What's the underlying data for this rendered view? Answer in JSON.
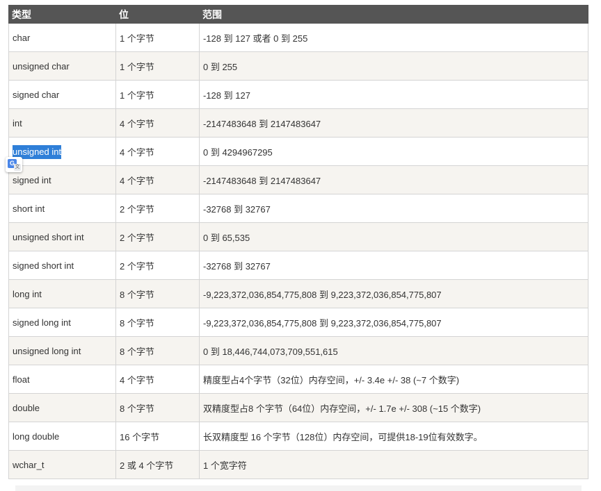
{
  "table": {
    "headers": [
      "类型",
      "位",
      "范围"
    ],
    "rows": [
      {
        "type": "char",
        "size": "1 个字节",
        "range": "-128 到 127 或者 0 到 255"
      },
      {
        "type": "unsigned char",
        "size": "1 个字节",
        "range": "0 到 255"
      },
      {
        "type": "signed char",
        "size": "1 个字节",
        "range": "-128 到 127"
      },
      {
        "type": "int",
        "size": "4 个字节",
        "range": "-2147483648 到 2147483647"
      },
      {
        "type": "unsigned int",
        "size": "4 个字节",
        "range": "0 到 4294967295",
        "selected": true
      },
      {
        "type": "signed int",
        "size": "4 个字节",
        "range": "-2147483648 到 2147483647"
      },
      {
        "type": "short int",
        "size": "2 个字节",
        "range": "-32768 到 32767"
      },
      {
        "type": "unsigned short int",
        "size": "2 个字节",
        "range": "0 到 65,535"
      },
      {
        "type": "signed short int",
        "size": "2 个字节",
        "range": "-32768 到 32767"
      },
      {
        "type": "long int",
        "size": "8 个字节",
        "range": "-9,223,372,036,854,775,808 到 9,223,372,036,854,775,807"
      },
      {
        "type": "signed long int",
        "size": "8 个字节",
        "range": "-9,223,372,036,854,775,808 到 9,223,372,036,854,775,807"
      },
      {
        "type": "unsigned long int",
        "size": "8 个字节",
        "range": "0 到 18,446,744,073,709,551,615"
      },
      {
        "type": "float",
        "size": "4 个字节",
        "range": "精度型占4个字节（32位）内存空间，+/- 3.4e +/- 38 (~7 个数字)"
      },
      {
        "type": "double",
        "size": "8 个字节",
        "range": "双精度型占8 个字节（64位）内存空间，+/- 1.7e +/- 308 (~15 个数字)"
      },
      {
        "type": "long double",
        "size": "16 个字节",
        "range": "长双精度型 16 个字节（128位）内存空间，可提供18-19位有效数字。"
      },
      {
        "type": "wchar_t",
        "size": "2 或 4 个字节",
        "range": "1 个宽字符"
      }
    ]
  },
  "translate_popup": {
    "icon": "google-translate-icon",
    "glyph_g": "G",
    "glyph_a": "文"
  },
  "colors": {
    "header_bg": "#555555",
    "row_alt_bg": "#f6f4f0",
    "selection": "#2f7fd8"
  }
}
